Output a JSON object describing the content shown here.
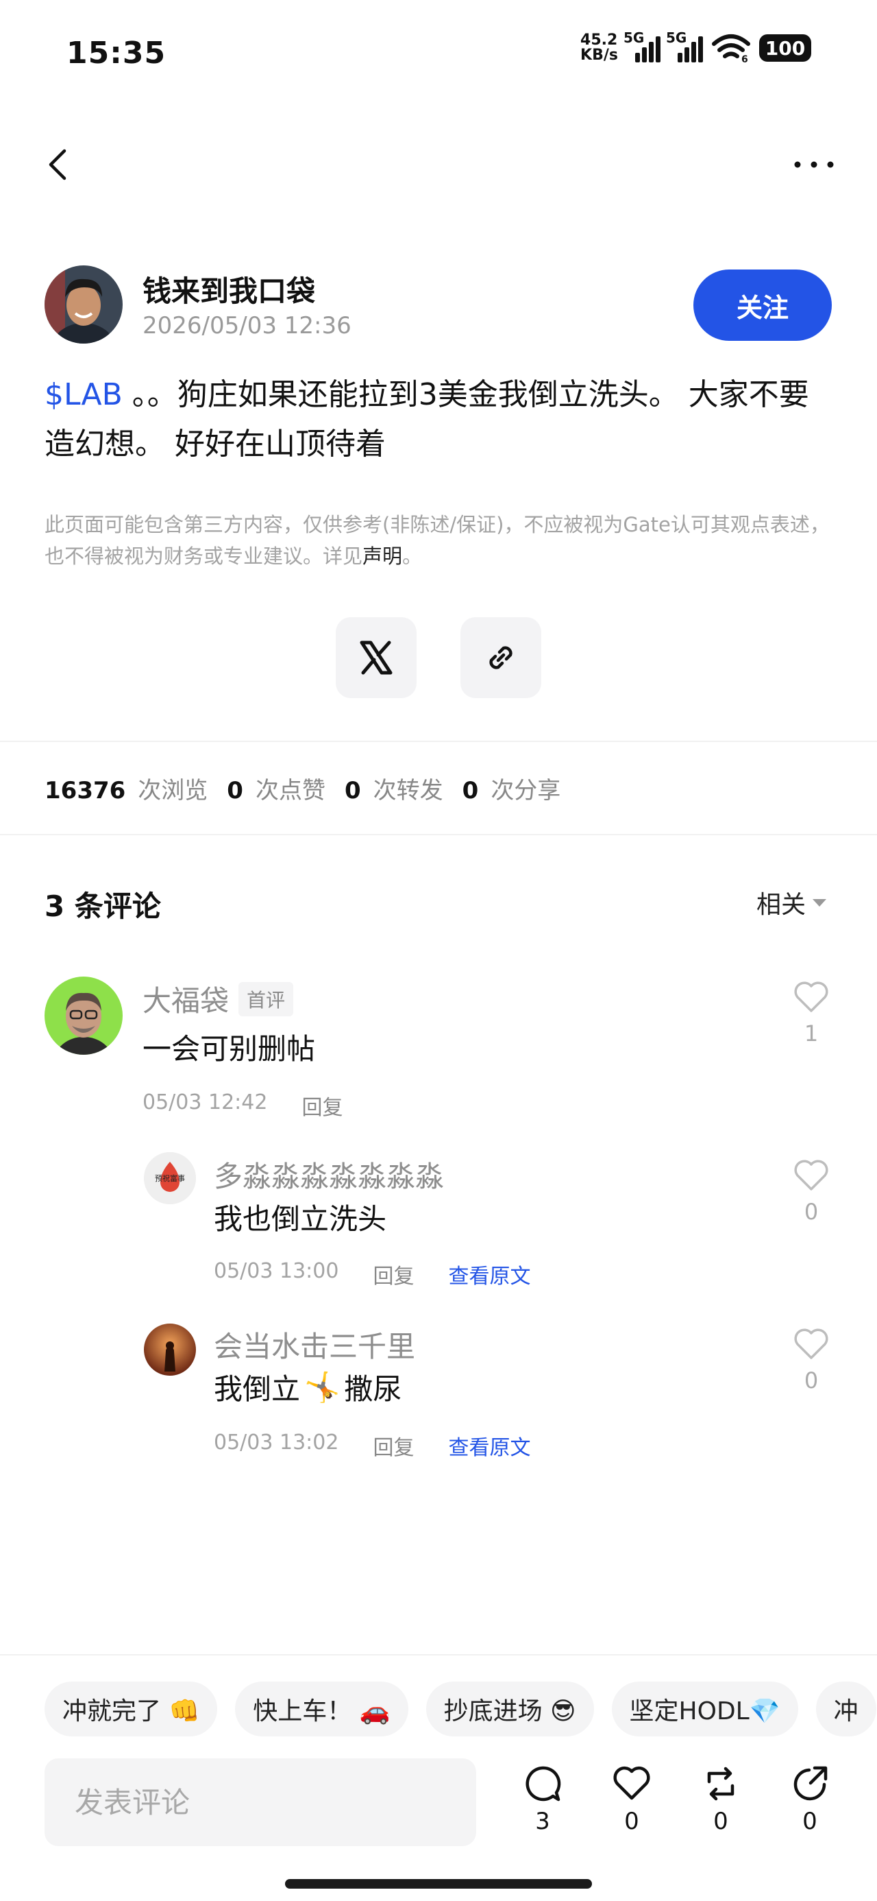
{
  "status_bar": {
    "time": "15:35",
    "net_speed_value": "45.2",
    "net_speed_unit": "KB/s",
    "sim1_label": "5G",
    "sim2_label": "5G",
    "wifi_label": "6",
    "battery": "100"
  },
  "nav": {
    "back_icon": "chevron-left-icon",
    "more_icon": "more-horizontal-icon"
  },
  "post": {
    "author_name": "钱来到我口袋",
    "timestamp": "2026/05/03 12:36",
    "follow_label": "关注",
    "ticker": "$LAB",
    "body": " 。。狗庄如果还能拉到3美金我倒立洗头。 大家不要造幻想。 好好在山顶待着",
    "disclaimer": "此页面可能包含第三方内容，仅供参考(非陈述/保证)，不应被视为Gate认可其观点表述，也不得被视为财务或专业建议。详见",
    "disclaimer_link": "声明",
    "disclaimer_end": "。"
  },
  "share": {
    "x_icon": "x-logo-icon",
    "link_icon": "link-icon"
  },
  "stats": {
    "views": "16376",
    "views_label": "次浏览",
    "likes": "0",
    "likes_label": "次点赞",
    "reposts": "0",
    "reposts_label": "次转发",
    "shares": "0",
    "shares_label": "次分享"
  },
  "comments_section": {
    "title": "3 条评论",
    "sort_label": "相关"
  },
  "comments": [
    {
      "name": "大福袋",
      "badge": "首评",
      "text": "一会可别删帖",
      "time": "05/03 12:42",
      "reply_label": "回复",
      "likes": "1"
    },
    {
      "name": "多淼淼淼淼淼淼淼",
      "avatar_text": "预祝富事",
      "text": "我也倒立洗头",
      "time": "05/03 13:00",
      "reply_label": "回复",
      "original_label": "查看原文",
      "likes": "0"
    },
    {
      "name": "会当水击三千里",
      "text_before": "我倒立",
      "emoji": "🤸",
      "text_after": "撒尿",
      "time": "05/03 13:02",
      "reply_label": "回复",
      "original_label": "查看原文",
      "likes": "0"
    }
  ],
  "quick_replies": [
    "冲就完了 👊",
    "快上车！ 🚗",
    "抄底进场 😎",
    "坚定HODL💎",
    "冲"
  ],
  "bottom_bar": {
    "input_placeholder": "发表评论",
    "comment_count": "3",
    "like_count": "0",
    "repost_count": "0",
    "share_count": "0"
  },
  "colors": {
    "accent": "#2354e6",
    "muted_text": "#9a9a9a"
  }
}
